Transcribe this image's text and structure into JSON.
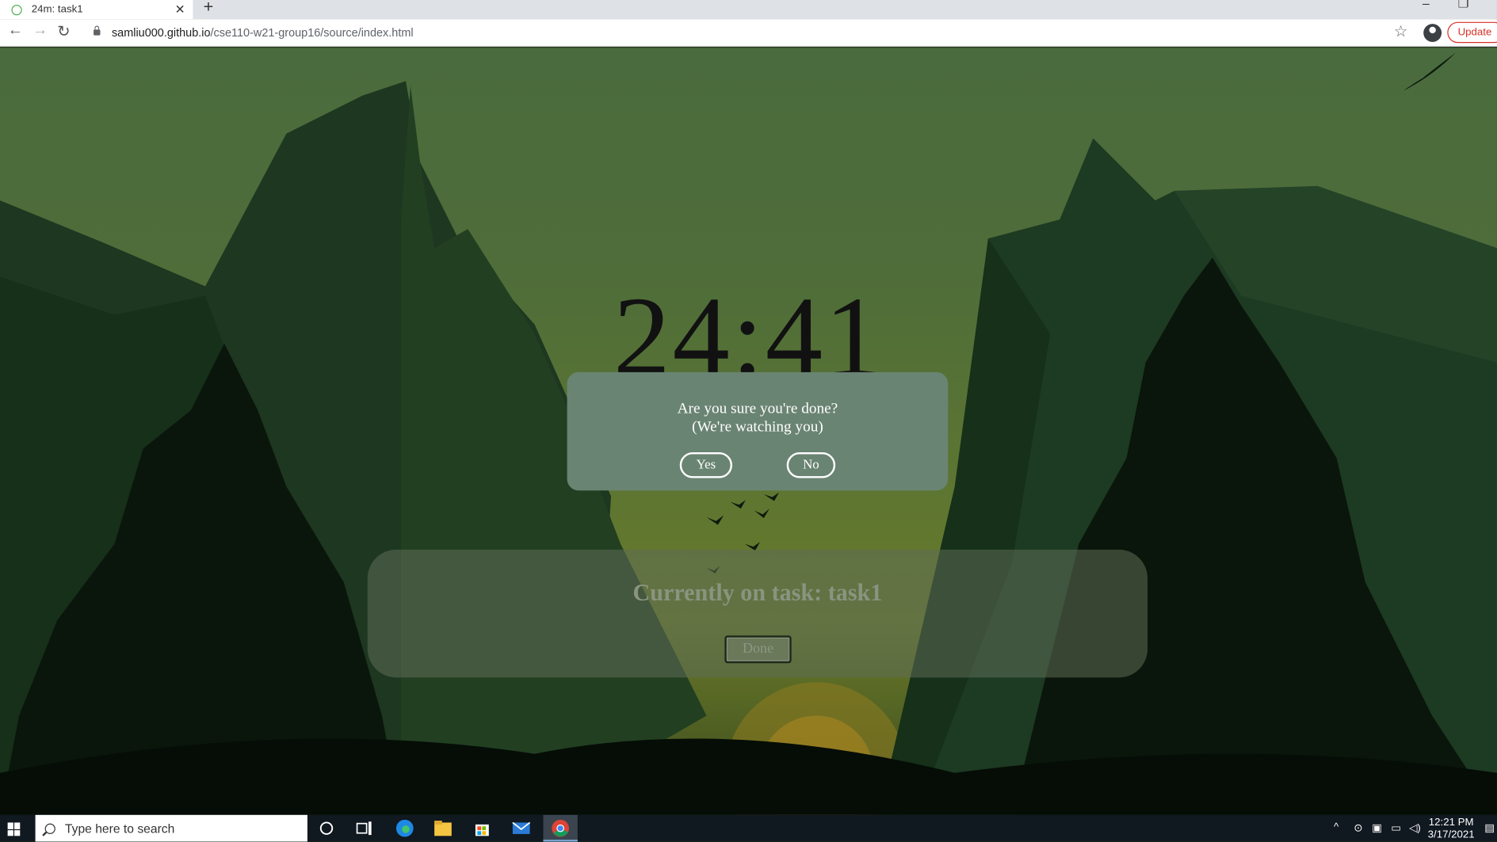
{
  "browser": {
    "tab_title": "24m: task1",
    "tab_close": "✕",
    "new_tab": "+",
    "url_host": "samliu000.github.io",
    "url_path": "/cse110-w21-group16/source/index.html",
    "update_label": "Update"
  },
  "timer": {
    "display": "24:41"
  },
  "task_panel": {
    "title": "Currently on task: task1",
    "done_label": "Done"
  },
  "modal": {
    "line1": "Are you sure you're done?",
    "line2": "(We're watching you)",
    "yes_label": "Yes",
    "no_label": "No"
  },
  "taskbar": {
    "search_placeholder": "Type here to search",
    "time": "12:21 PM",
    "date": "3/17/2021",
    "pinned_icons": [
      "cortana-icon",
      "task-view-icon",
      "edge-icon",
      "file-explorer-icon",
      "store-icon",
      "mail-icon",
      "chrome-icon"
    ]
  },
  "colors": {
    "modal_bg": "#6a8473",
    "update_accent": "#d93025",
    "timer_text": "#111111"
  }
}
